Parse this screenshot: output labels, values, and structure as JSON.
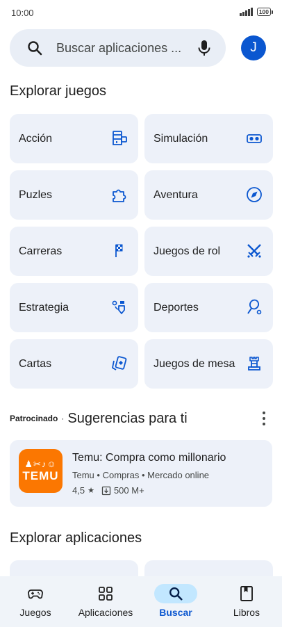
{
  "status_bar": {
    "time": "10:00",
    "battery": "100"
  },
  "search": {
    "placeholder": "Buscar aplicaciones ...",
    "avatar_initial": "J"
  },
  "games_section": {
    "title": "Explorar juegos",
    "categories": [
      {
        "label": "Acción",
        "icon": "arcade-icon"
      },
      {
        "label": "Simulación",
        "icon": "vr-headset-icon"
      },
      {
        "label": "Puzles",
        "icon": "puzzle-icon"
      },
      {
        "label": "Aventura",
        "icon": "compass-icon"
      },
      {
        "label": "Carreras",
        "icon": "checkered-flag-icon"
      },
      {
        "label": "Juegos de rol",
        "icon": "crossed-swords-icon"
      },
      {
        "label": "Estrategia",
        "icon": "strategy-flag-icon"
      },
      {
        "label": "Deportes",
        "icon": "racket-icon"
      },
      {
        "label": "Cartas",
        "icon": "cards-icon"
      },
      {
        "label": "Juegos de mesa",
        "icon": "chess-rook-icon"
      }
    ]
  },
  "suggestions": {
    "sponsored_label": "Patrocinado",
    "separator": "·",
    "title": "Sugerencias para ti",
    "app": {
      "name": "Temu: Compra como millonario",
      "developer": "Temu",
      "category": "Compras",
      "tag": "Mercado online",
      "rating": "4,5",
      "downloads": "500 M+",
      "icon_text": "TEMU",
      "icon_color": "#fb7701"
    }
  },
  "apps_section": {
    "title": "Explorar aplicaciones"
  },
  "bottom_nav": {
    "items": [
      {
        "label": "Juegos",
        "icon": "gamepad-icon",
        "active": false
      },
      {
        "label": "Aplicaciones",
        "icon": "apps-grid-icon",
        "active": false
      },
      {
        "label": "Buscar",
        "icon": "search-icon",
        "active": true
      },
      {
        "label": "Libros",
        "icon": "book-icon",
        "active": false
      }
    ]
  },
  "colors": {
    "accent": "#0b57d0",
    "tile_bg": "#edf1f9",
    "search_bg": "#e9eef6",
    "active_pill": "#c2e7ff"
  }
}
